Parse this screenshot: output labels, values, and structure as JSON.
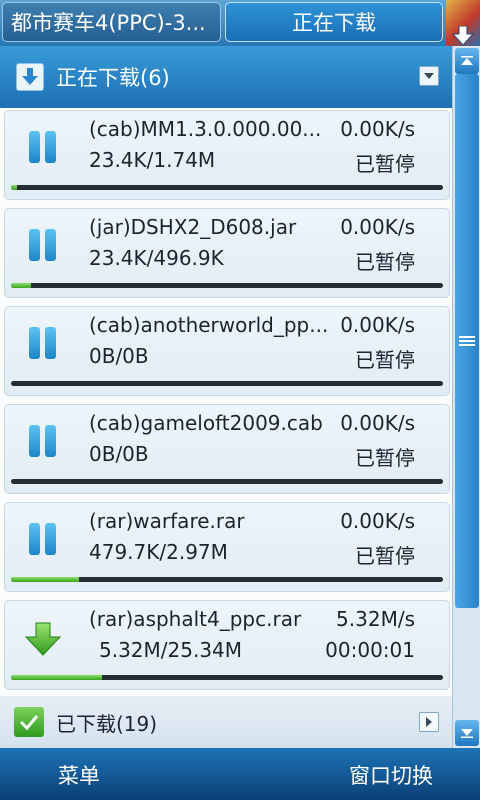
{
  "tabs": [
    {
      "label": "都市赛车4(PPC)-3...",
      "active": false
    },
    {
      "label": "正在下载",
      "active": true
    }
  ],
  "section": {
    "title": "正在下载(6)",
    "icon": "download-arrow-icon"
  },
  "downloads": [
    {
      "name": "(cab)MM1.3.0.000.00...",
      "speed": "0.00K/s",
      "size": "23.4K/1.74M",
      "status": "已暂停",
      "state": "paused",
      "progress": 0.013
    },
    {
      "name": "(jar)DSHX2_D608.jar",
      "speed": "0.00K/s",
      "size": "23.4K/496.9K",
      "status": "已暂停",
      "state": "paused",
      "progress": 0.047
    },
    {
      "name": "(cab)anotherworld_pp...",
      "speed": "0.00K/s",
      "size": "0B/0B",
      "status": "已暂停",
      "state": "paused",
      "progress": 0
    },
    {
      "name": "(cab)gameloft2009.cab",
      "speed": "0.00K/s",
      "size": "0B/0B",
      "status": "已暂停",
      "state": "paused",
      "progress": 0
    },
    {
      "name": "(rar)warfare.rar",
      "speed": "0.00K/s",
      "size": "479.7K/2.97M",
      "status": "已暂停",
      "state": "paused",
      "progress": 0.158
    },
    {
      "name": "(rar)asphalt4_ppc.rar",
      "speed": "5.32M/s",
      "size": "5.32M/25.34M",
      "status": "00:00:01",
      "state": "downloading",
      "progress": 0.21
    }
  ],
  "downloaded": {
    "title": "已下载(19)"
  },
  "softkeys": {
    "left": "菜单",
    "right": "窗口切换"
  },
  "colors": {
    "accent": "#1c6fb4",
    "progress": "#36a51f",
    "pause": "#2a95d6"
  }
}
